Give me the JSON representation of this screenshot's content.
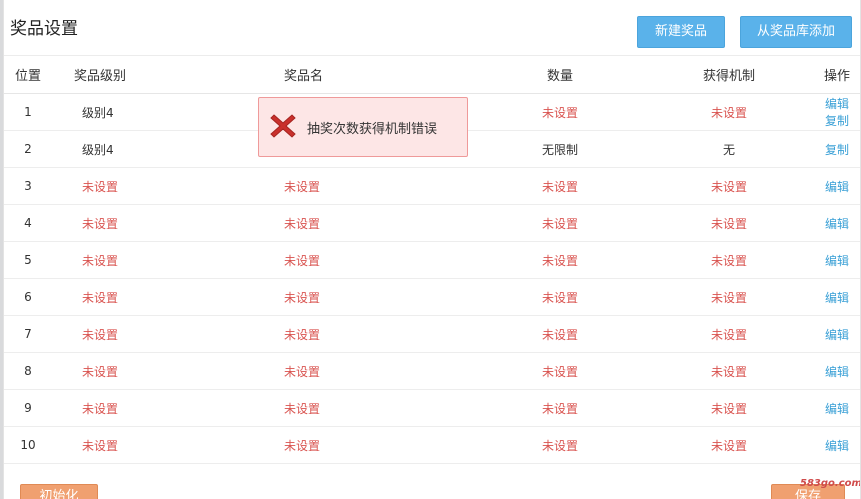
{
  "header": {
    "title": "奖品设置",
    "new_button": "新建奖品",
    "library_button": "从奖品库添加"
  },
  "table": {
    "columns": [
      "位置",
      "奖品级别",
      "奖品名",
      "数量",
      "获得机制",
      "操作"
    ],
    "rows": [
      {
        "pos": "1",
        "level": "级别4",
        "name": "",
        "qty": "未设置",
        "mech": "未设置",
        "op1": "编辑",
        "op2": "复制"
      },
      {
        "pos": "2",
        "level": "级别4",
        "name": "",
        "qty": "无限制",
        "mech": "无",
        "op1": "",
        "op2": "复制"
      },
      {
        "pos": "3",
        "level": "未设置",
        "name": "未设置",
        "qty": "未设置",
        "mech": "未设置",
        "op1": "编辑",
        "op2": ""
      },
      {
        "pos": "4",
        "level": "未设置",
        "name": "未设置",
        "qty": "未设置",
        "mech": "未设置",
        "op1": "编辑",
        "op2": ""
      },
      {
        "pos": "5",
        "level": "未设置",
        "name": "未设置",
        "qty": "未设置",
        "mech": "未设置",
        "op1": "编辑",
        "op2": ""
      },
      {
        "pos": "6",
        "level": "未设置",
        "name": "未设置",
        "qty": "未设置",
        "mech": "未设置",
        "op1": "编辑",
        "op2": ""
      },
      {
        "pos": "7",
        "level": "未设置",
        "name": "未设置",
        "qty": "未设置",
        "mech": "未设置",
        "op1": "编辑",
        "op2": ""
      },
      {
        "pos": "8",
        "level": "未设置",
        "name": "未设置",
        "qty": "未设置",
        "mech": "未设置",
        "op1": "编辑",
        "op2": ""
      },
      {
        "pos": "9",
        "level": "未设置",
        "name": "未设置",
        "qty": "未设置",
        "mech": "未设置",
        "op1": "编辑",
        "op2": ""
      },
      {
        "pos": "10",
        "level": "未设置",
        "name": "未设置",
        "qty": "未设置",
        "mech": "未设置",
        "op1": "编辑",
        "op2": ""
      }
    ]
  },
  "toast": {
    "message": "抽奖次数获得机制错误",
    "icon": "error-x-icon"
  },
  "footer": {
    "init_button": "初始化",
    "save_button": "保存"
  },
  "watermark": "583go.com",
  "colors": {
    "primary": "#5ab2ea",
    "unset_text": "#d9534f",
    "link": "#3aa0d6",
    "footer_button": "#f0a070",
    "toast_bg": "#fde6e6"
  }
}
